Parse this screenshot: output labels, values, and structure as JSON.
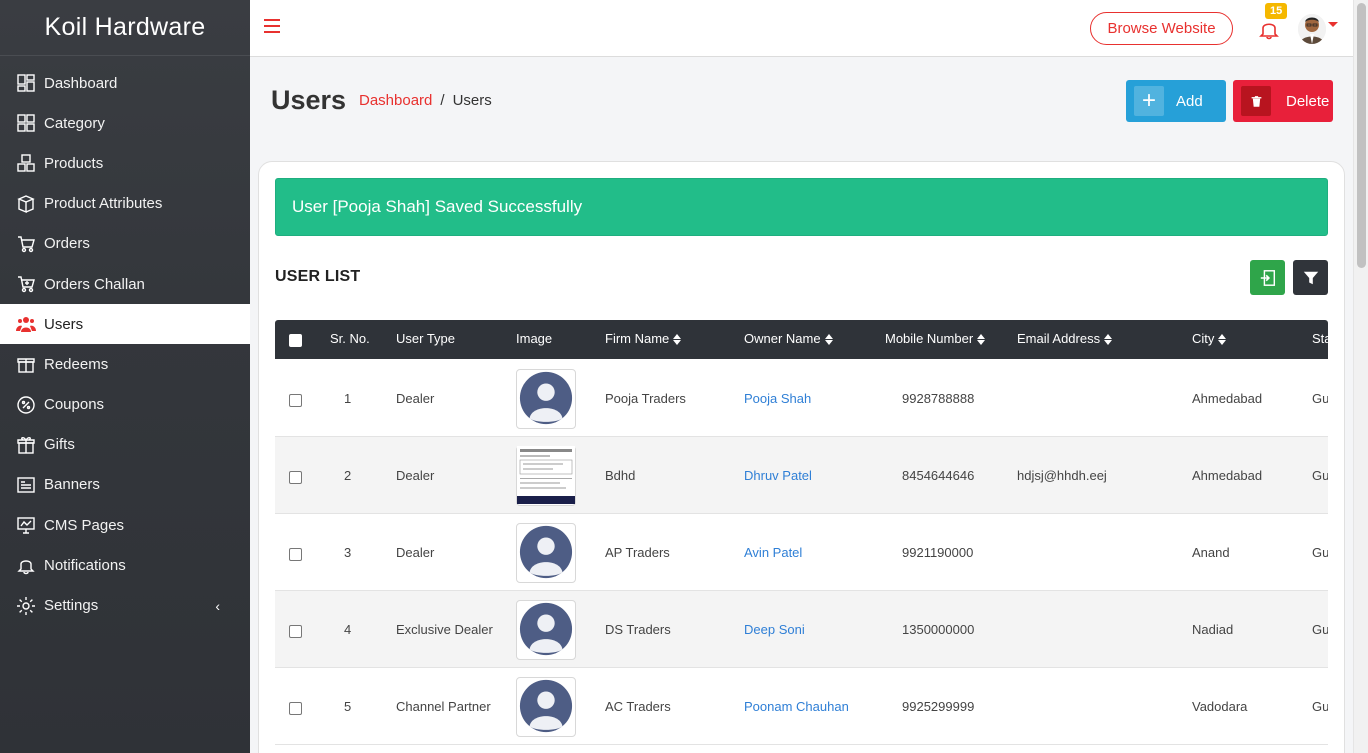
{
  "sidebar": {
    "brand": "Koil Hardware",
    "items": [
      {
        "label": "Dashboard",
        "icon": "dashboard-icon"
      },
      {
        "label": "Category",
        "icon": "category-icon"
      },
      {
        "label": "Products",
        "icon": "products-icon"
      },
      {
        "label": "Product Attributes",
        "icon": "attributes-icon"
      },
      {
        "label": "Orders",
        "icon": "orders-icon"
      },
      {
        "label": "Orders Challan",
        "icon": "cart-icon"
      },
      {
        "label": "Users",
        "icon": "users-icon",
        "active": true
      },
      {
        "label": "Redeems",
        "icon": "redeem-icon"
      },
      {
        "label": "Coupons",
        "icon": "coupon-icon"
      },
      {
        "label": "Gifts",
        "icon": "gift-icon"
      },
      {
        "label": "Banners",
        "icon": "banner-icon"
      },
      {
        "label": "CMS Pages",
        "icon": "cms-icon"
      },
      {
        "label": "Notifications",
        "icon": "bell-icon"
      },
      {
        "label": "Settings",
        "icon": "gear-icon",
        "chevron": "‹"
      }
    ]
  },
  "topbar": {
    "browse_label": "Browse Website",
    "notification_count": "15",
    "accent_color": "#e8312f"
  },
  "page": {
    "title": "Users",
    "breadcrumb": {
      "home": "Dashboard",
      "separator": "/",
      "current": "Users"
    },
    "add_label": "Add",
    "delete_label": "Delete"
  },
  "alert": {
    "message": "User [Pooja Shah] Saved Successfully",
    "color": "#22bd89"
  },
  "list": {
    "title": "USER LIST",
    "columns": [
      "Sr. No.",
      "User Type",
      "Image",
      "Firm Name",
      "Owner Name",
      "Mobile Number",
      "Email Address",
      "City",
      "Sta"
    ],
    "rows": [
      {
        "sr": "1",
        "type": "Dealer",
        "image": "avatar-placeholder",
        "firm": "Pooja Traders",
        "owner": "Pooja Shah",
        "mobile": "9928788888",
        "email": "",
        "city": "Ahmedabad",
        "state": "Gu"
      },
      {
        "sr": "2",
        "type": "Dealer",
        "image": "document-thumbnail",
        "firm": "Bdhd",
        "owner": "Dhruv Patel",
        "mobile": "8454644646",
        "email": "hdjsj@hhdh.eej",
        "city": "Ahmedabad",
        "state": "Gu"
      },
      {
        "sr": "3",
        "type": "Dealer",
        "image": "avatar-placeholder",
        "firm": "AP Traders",
        "owner": "Avin Patel",
        "mobile": "9921190000",
        "email": "",
        "city": "Anand",
        "state": "Gu"
      },
      {
        "sr": "4",
        "type": "Exclusive Dealer",
        "image": "avatar-placeholder",
        "firm": "DS Traders",
        "owner": "Deep Soni",
        "mobile": "1350000000",
        "email": "",
        "city": "Nadiad",
        "state": "Gu"
      },
      {
        "sr": "5",
        "type": "Channel Partner",
        "image": "avatar-placeholder",
        "firm": "AC Traders",
        "owner": "Poonam Chauhan",
        "mobile": "9925299999",
        "email": "",
        "city": "Vadodara",
        "state": "Gu"
      }
    ]
  }
}
